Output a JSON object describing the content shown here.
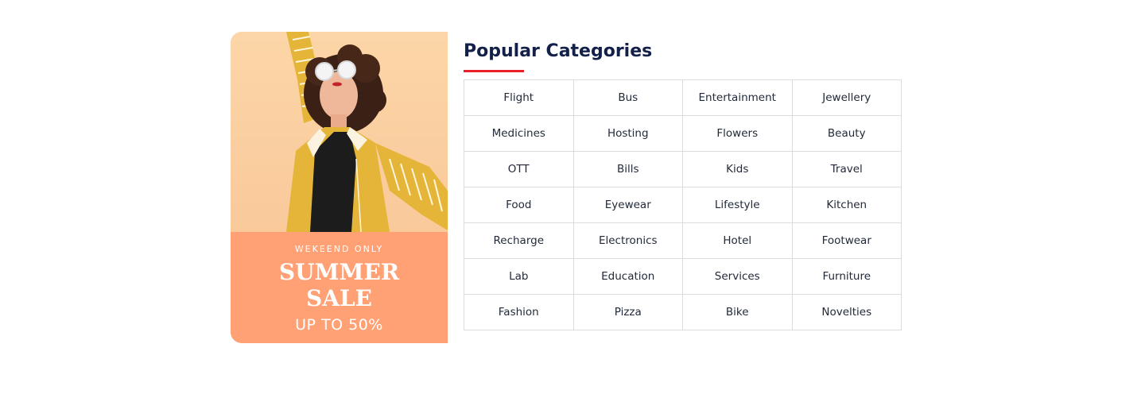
{
  "promo": {
    "kicker": "WEKEEND ONLY",
    "headline": "SUMMER\nSALE",
    "discount": "UP TO 50%",
    "colors": {
      "photo_background": "#fcd6a8",
      "caption_background": "#ffa174",
      "jacket": "#e5b53a",
      "text": "#ffffff"
    }
  },
  "categories_section": {
    "title": "Popular Categories",
    "accent_color": "#e8202a",
    "items": [
      "Flight",
      "Bus",
      "Entertainment",
      "Jewellery",
      "Medicines",
      "Hosting",
      "Flowers",
      "Beauty",
      "OTT",
      "Bills",
      "Kids",
      "Travel",
      "Food",
      "Eyewear",
      "Lifestyle",
      "Kitchen",
      "Recharge",
      "Electronics",
      "Hotel",
      "Footwear",
      "Lab",
      "Education",
      "Services",
      "Furniture",
      "Fashion",
      "Pizza",
      "Bike",
      "Novelties"
    ]
  }
}
